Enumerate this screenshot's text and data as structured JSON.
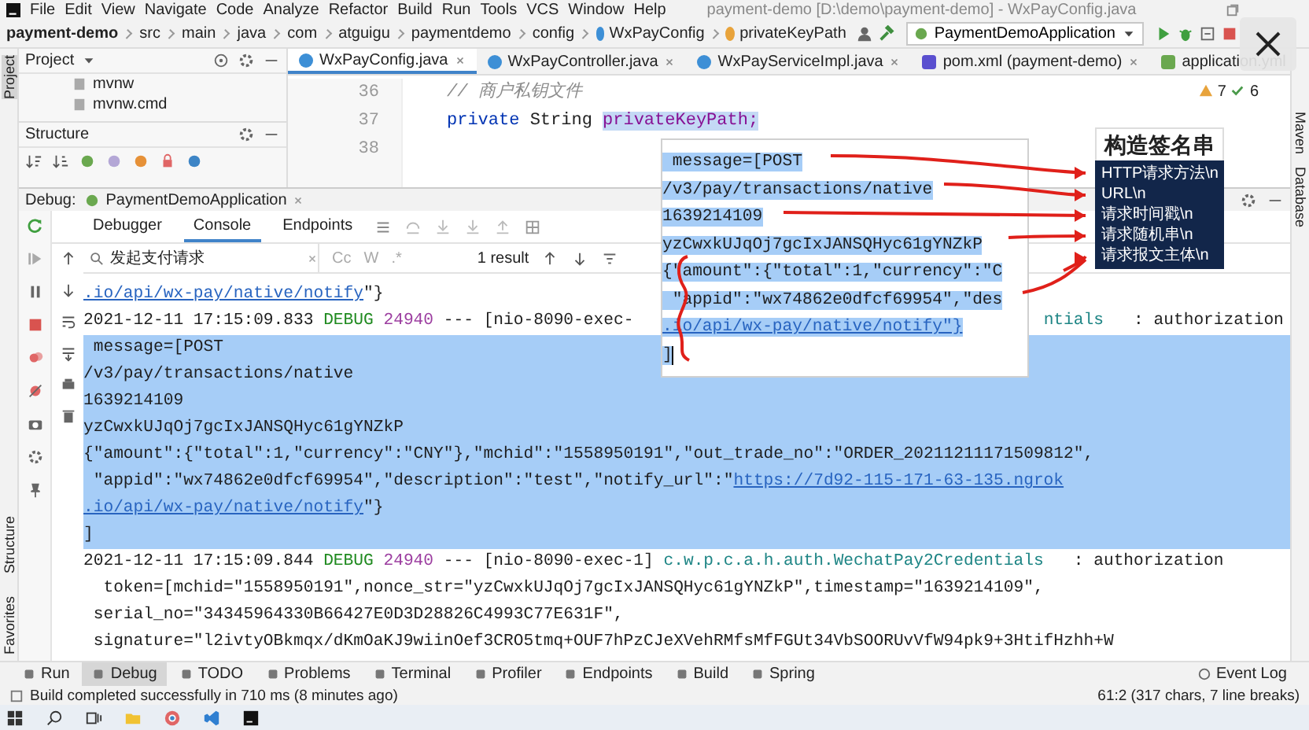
{
  "menu_bar": {
    "items": [
      "File",
      "Edit",
      "View",
      "Navigate",
      "Code",
      "Analyze",
      "Refactor",
      "Build",
      "Run",
      "Tools",
      "VCS",
      "Window",
      "Help"
    ],
    "title": "payment-demo [D:\\demo\\payment-demo] - WxPayConfig.java"
  },
  "breadcrumb": [
    {
      "label": "payment-demo",
      "kind": "project"
    },
    {
      "label": "src",
      "kind": "folder"
    },
    {
      "label": "main",
      "kind": "folder"
    },
    {
      "label": "java",
      "kind": "folder"
    },
    {
      "label": "com",
      "kind": "folder"
    },
    {
      "label": "atguigu",
      "kind": "folder"
    },
    {
      "label": "paymentdemo",
      "kind": "folder"
    },
    {
      "label": "config",
      "kind": "folder"
    },
    {
      "label": "WxPayConfig",
      "kind": "class"
    },
    {
      "label": "privateKeyPath",
      "kind": "field"
    }
  ],
  "run_config": "PaymentDemoApplication",
  "side_strip": {
    "top": "Project",
    "bottom": [
      "Structure",
      "Favorites"
    ]
  },
  "right_strip": [
    "Maven",
    "Database"
  ],
  "project_panel": {
    "title": "Project",
    "items": [
      "mvnw",
      "mvnw.cmd"
    ]
  },
  "structure_panel": {
    "title": "Structure"
  },
  "editor": {
    "tabs": [
      {
        "label": "WxPayConfig.java",
        "kind": "class",
        "selected": true
      },
      {
        "label": "WxPayController.java",
        "kind": "class",
        "selected": false
      },
      {
        "label": "WxPayServiceImpl.java",
        "kind": "class",
        "selected": false
      },
      {
        "label": "pom.xml (payment-demo)",
        "kind": "maven",
        "selected": false
      },
      {
        "label": "application.yml",
        "kind": "yaml",
        "selected": false
      }
    ],
    "warnings": "7",
    "checks": "6",
    "lines": [
      {
        "number": "36",
        "segments": [
          {
            "kind": "comment",
            "text": "// 商户私钥文件"
          }
        ]
      },
      {
        "number": "37",
        "segments": [
          {
            "kind": "keyword",
            "text": "private "
          },
          {
            "kind": "plain",
            "text": "String "
          },
          {
            "kind": "highlight",
            "text": "privateKeyPath;"
          }
        ]
      },
      {
        "number": "38"
      }
    ]
  },
  "debug": {
    "title": "Debug:",
    "session": "PaymentDemoApplication",
    "tabs": [
      {
        "label": "Debugger",
        "selected": false
      },
      {
        "label": "Console",
        "selected": true
      },
      {
        "label": "Endpoints",
        "selected": false
      }
    ],
    "search": {
      "value": "发起支付请求",
      "options": [
        "Cc",
        "W",
        ".*"
      ],
      "result_count": "1 result"
    },
    "console": [
      {
        "selected": false,
        "segments": [
          {
            "kind": "link",
            "text": ".io/api/wx-pay/native/notify"
          },
          {
            "kind": "plain",
            "text": "\"}"
          }
        ]
      },
      {
        "selected": false,
        "segments": [
          {
            "kind": "plain",
            "text": "2021-12-11 17:15:09.833 "
          },
          {
            "kind": "level",
            "text": "DEBUG"
          },
          {
            "kind": "pid",
            "text": " 24940"
          },
          {
            "kind": "plain",
            "text": " --- [nio-8090-exec-"
          },
          {
            "kind": "gap"
          },
          {
            "kind": "logger",
            "text": "ntials"
          },
          {
            "kind": "plain",
            "text": "   : authorization"
          }
        ]
      },
      {
        "selected": true,
        "segments": [
          {
            "kind": "plain",
            "text": " message=[POST"
          }
        ]
      },
      {
        "selected": true,
        "segments": [
          {
            "kind": "plain",
            "text": "/v3/pay/transactions/native"
          }
        ]
      },
      {
        "selected": true,
        "segments": [
          {
            "kind": "plain",
            "text": "1639214109"
          }
        ]
      },
      {
        "selected": true,
        "segments": [
          {
            "kind": "plain",
            "text": "yzCwxkUJqOj7gcIxJANSQHyc61gYNZkP"
          }
        ]
      },
      {
        "selected": true,
        "segments": [
          {
            "kind": "plain",
            "text": "{\"amount\":{\"total\":1,\"currency\":\"CNY\"},\"mchid\":\"1558950191\",\"out_trade_no\":\"ORDER_20211211171509812\","
          }
        ]
      },
      {
        "selected": true,
        "segments": [
          {
            "kind": "plain",
            "text": " \"appid\":\"wx74862e0dfcf69954\",\"description\":\"test\",\"notify_url\":\""
          },
          {
            "kind": "link",
            "text": "https://7d92-115-171-63-135.ngrok"
          }
        ]
      },
      {
        "selected": true,
        "segments": [
          {
            "kind": "link",
            "text": ".io/api/wx-pay/native/notify"
          },
          {
            "kind": "plain",
            "text": "\"}"
          }
        ]
      },
      {
        "selected": true,
        "segments": [
          {
            "kind": "plain",
            "text": "]"
          }
        ]
      },
      {
        "selected": false,
        "segments": [
          {
            "kind": "plain",
            "text": "2021-12-11 17:15:09.844 "
          },
          {
            "kind": "level",
            "text": "DEBUG"
          },
          {
            "kind": "pid",
            "text": " 24940"
          },
          {
            "kind": "plain",
            "text": " --- [nio-8090-exec-1] "
          },
          {
            "kind": "logger",
            "text": "c.w.p.c.a.h.auth.WechatPay2Credentials"
          },
          {
            "kind": "plain",
            "text": "   : authorization"
          }
        ]
      },
      {
        "selected": false,
        "segments": [
          {
            "kind": "plain",
            "text": "  token=[mchid=\"1558950191\",nonce_str=\"yzCwxkUJqOj7gcIxJANSQHyc61gYNZkP\",timestamp=\"1639214109\","
          }
        ]
      },
      {
        "selected": false,
        "segments": [
          {
            "kind": "plain",
            "text": " serial_no=\"34345964330B66427E0D3D28826C4993C77E631F\","
          }
        ]
      },
      {
        "selected": false,
        "segments": [
          {
            "kind": "plain",
            "text": " signature=\"l2ivtyOBkmqx/dKmOaKJ9wiinOef3CRO5tmq+OUF7hPzCJeXVehRMfsMfFGUt34VbSOORUvVfW94pk9+3HtifHzhh+W"
          }
        ]
      }
    ]
  },
  "popup": {
    "lines": [
      {
        "text": " message=[POST",
        "kind": "plain"
      },
      {
        "text": "/v3/pay/transactions/native",
        "kind": "plain"
      },
      {
        "text": "1639214109",
        "kind": "plain"
      },
      {
        "text": "yzCwxkUJqOj7gcIxJANSQHyc61gYNZkP",
        "kind": "plain"
      },
      {
        "text": "{\"amount\":{\"total\":1,\"currency\":\"C",
        "kind": "plain"
      },
      {
        "text": " \"appid\":\"wx74862e0dfcf69954\",\"des",
        "kind": "plain"
      },
      {
        "text": ".io/api/wx-pay/native/notify\"}",
        "kind": "link"
      },
      {
        "text": "]",
        "kind": "plain"
      }
    ]
  },
  "annotation": {
    "title": "构造签名串",
    "items": [
      "HTTP请求方法\\n",
      "URL\\n",
      "请求时间戳\\n",
      "请求随机串\\n",
      "请求报文主体\\n"
    ]
  },
  "tool_windows": {
    "items": [
      {
        "label": "Run",
        "selected": false
      },
      {
        "label": "Debug",
        "selected": true
      },
      {
        "label": "TODO",
        "selected": false
      },
      {
        "label": "Problems",
        "selected": false
      },
      {
        "label": "Terminal",
        "selected": false
      },
      {
        "label": "Profiler",
        "selected": false
      },
      {
        "label": "Endpoints",
        "selected": false
      },
      {
        "label": "Build",
        "selected": false
      },
      {
        "label": "Spring",
        "selected": false
      }
    ],
    "event_log": "Event Log"
  },
  "status_bar": {
    "message": "Build completed successfully in 710 ms (8 minutes ago)",
    "position": "61:2 (317 chars, 7 line breaks)"
  }
}
